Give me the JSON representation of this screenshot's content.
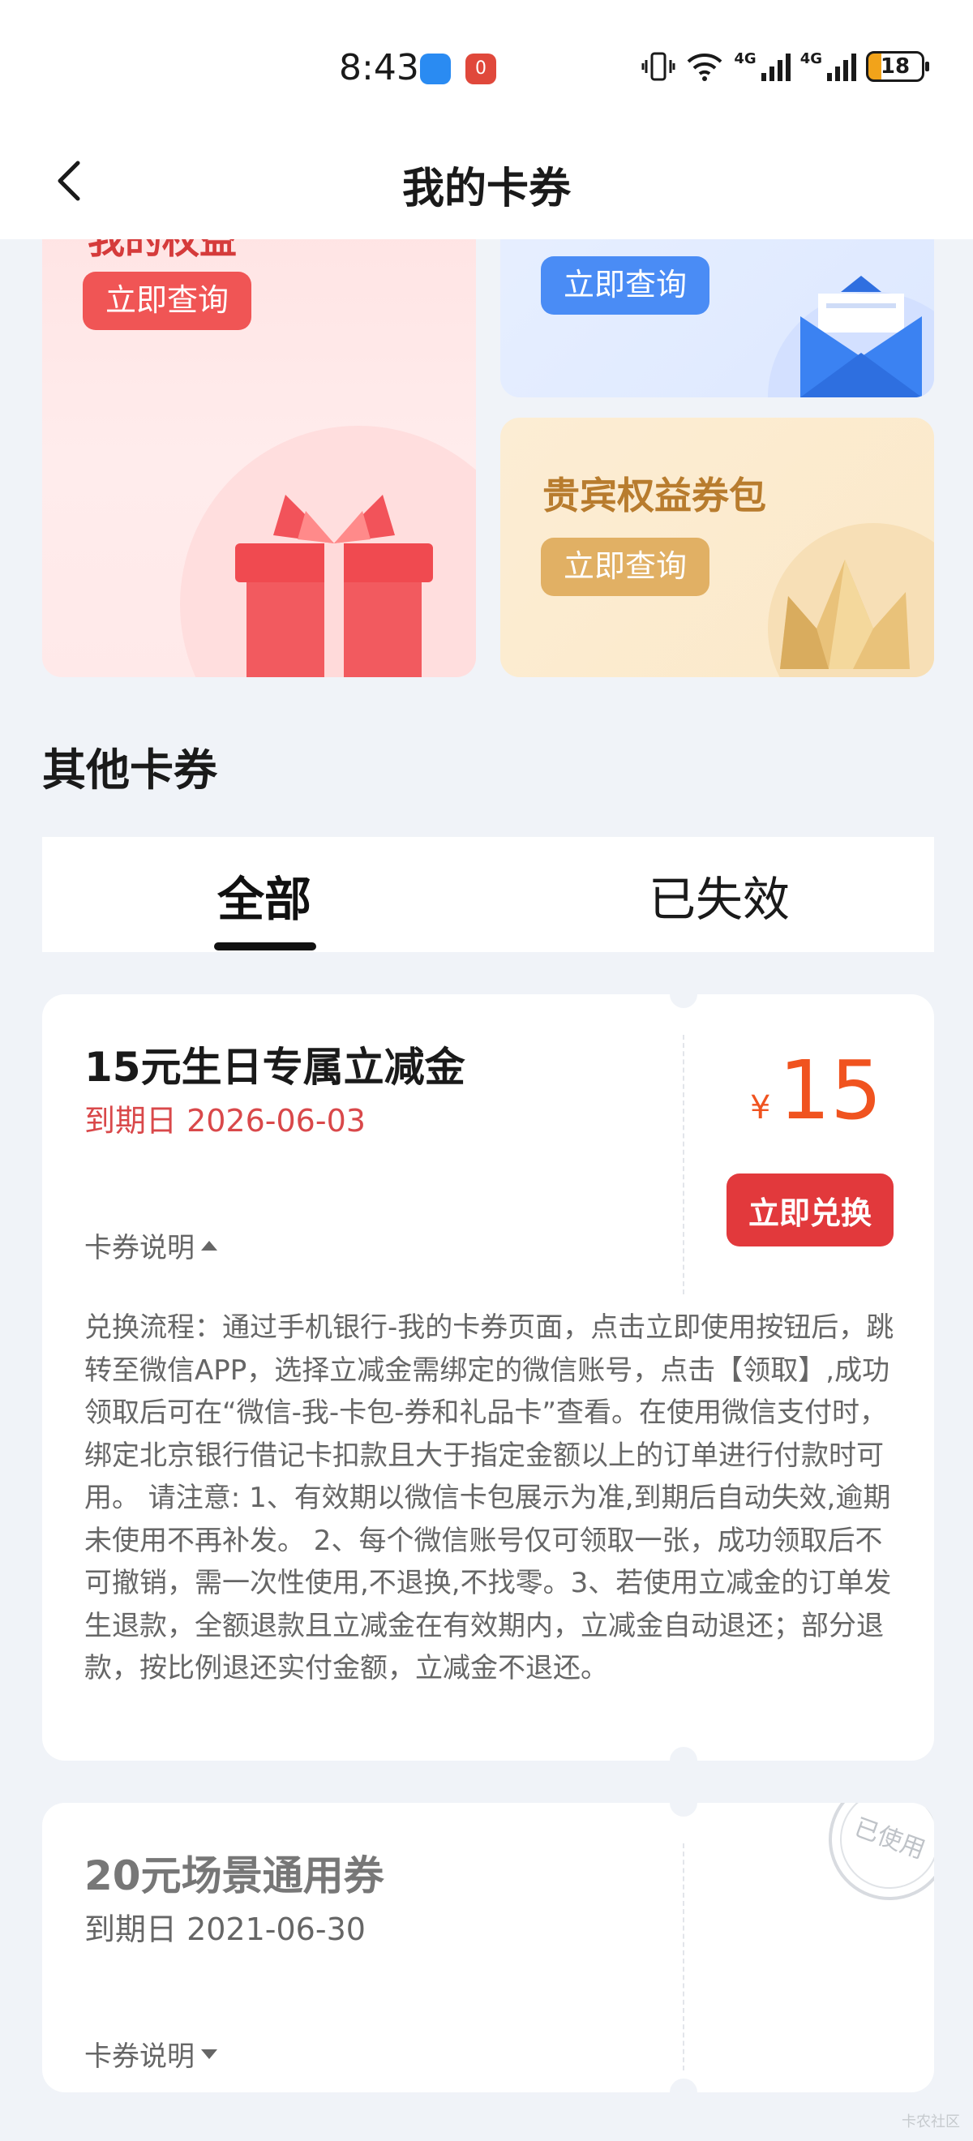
{
  "status_bar": {
    "time": "8:43",
    "notif_badge": "0",
    "net1": "4G",
    "net2": "4G",
    "battery": "18"
  },
  "header": {
    "title": "我的卡券"
  },
  "promo_cards": {
    "left": {
      "title": "我的权益",
      "button": "立即查询"
    },
    "top_right": {
      "button": "立即查询"
    },
    "bottom_right": {
      "title": "贵宾权益券包",
      "button": "立即查询"
    }
  },
  "section": {
    "title": "其他卡券"
  },
  "tabs": [
    {
      "label": "全部",
      "active": true
    },
    {
      "label": "已失效",
      "active": false
    }
  ],
  "coupons": [
    {
      "title": "15元生日专属立减金",
      "expiry": "到期日 2026-06-03",
      "currency": "¥",
      "amount": "15",
      "action": "立即兑换",
      "explain_label": "卡券说明",
      "description": "兑换流程：通过手机银行-我的卡券页面，点击立即使用按钮后，跳转至微信APP，选择立减金需绑定的微信账号，点击【领取】,成功领取后可在“微信-我-卡包-券和礼品卡”查看。在使用微信支付时，绑定北京银行借记卡扣款且大于指定金额以上的订单进行付款时可用。 请注意: 1、有效期以微信卡包展示为准,到期后自动失效,逾期未使用不再补发。 2、每个微信账号仅可领取一张，成功领取后不可撤销，需一次性使用,不退换,不找零。3、若使用立减金的订单发生退款，全额退款且立减金在有效期内，立减金自动退还；部分退款，按比例退还实付金额，立减金不退还。"
    },
    {
      "title": "20元场景通用券",
      "expiry": "到期日 2021-06-30",
      "explain_label": "卡券说明",
      "stamp": "已使用"
    }
  ],
  "watermark": "卡农社区",
  "colors": {
    "accent_red": "#e2393c",
    "price_orange": "#f0531f",
    "expiry_red": "#d9484a",
    "page_bg": "#f0f3f8"
  }
}
